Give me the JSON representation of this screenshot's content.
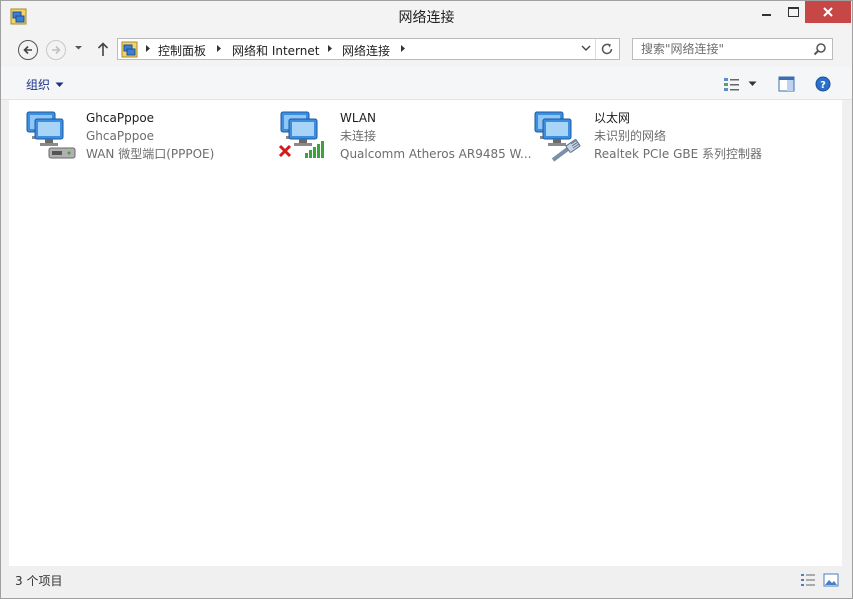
{
  "window": {
    "title": "网络连接"
  },
  "nav": {
    "breadcrumbs": [
      "控制面板",
      "网络和 Internet",
      "网络连接"
    ],
    "search_placeholder": "搜索\"网络连接\""
  },
  "commandbar": {
    "organize_label": "组织"
  },
  "connections": [
    {
      "name": "GhcaPppoe",
      "status": "GhcaPppoe",
      "device": "WAN 微型端口(PPPOE)",
      "icon": "pppoe-connection-icon"
    },
    {
      "name": "WLAN",
      "status": "未连接",
      "device": "Qualcomm Atheros AR9485 W...",
      "icon": "wlan-disconnected-icon"
    },
    {
      "name": "以太网",
      "status": "未识别的网络",
      "device": "Realtek PCIe GBE 系列控制器",
      "icon": "ethernet-connection-icon"
    }
  ],
  "statusbar": {
    "item_count": "3 个项目"
  },
  "colors": {
    "close_button": "#c74646",
    "link_blue": "#1e3287",
    "signal_green": "#3aa33a",
    "error_red": "#d21a1a"
  }
}
